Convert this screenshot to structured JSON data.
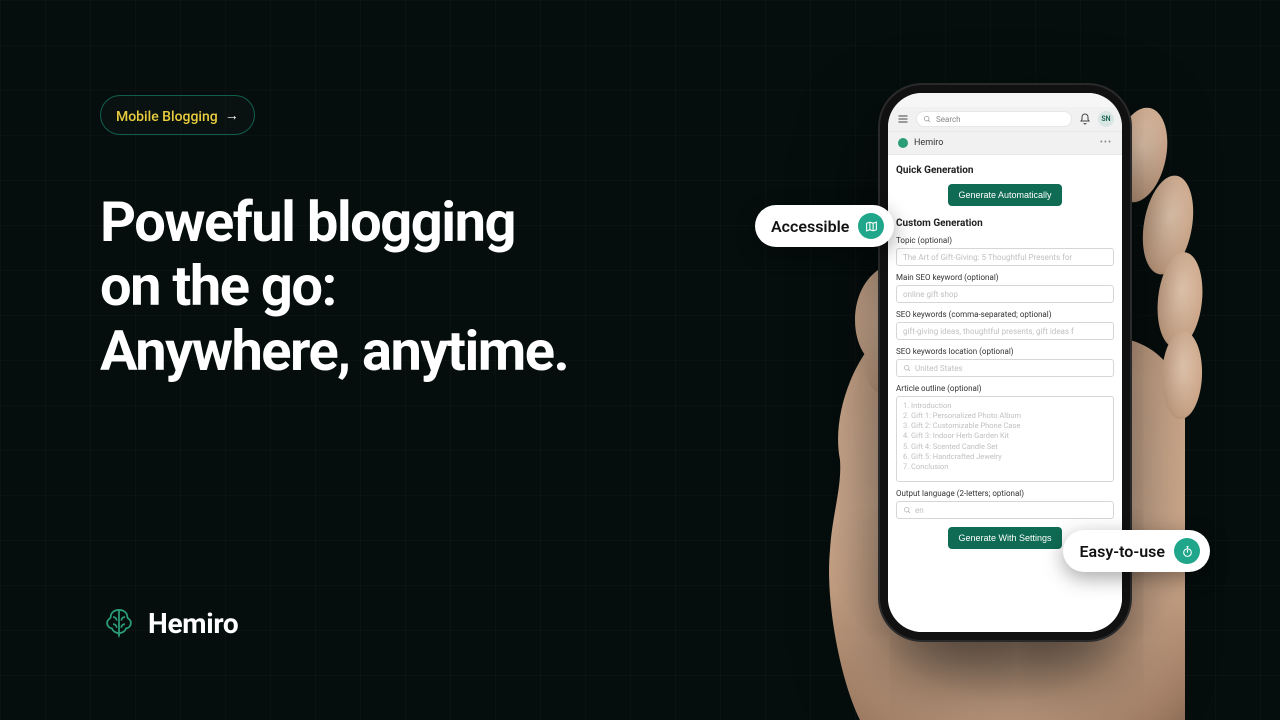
{
  "tag": {
    "label": "Mobile Blogging",
    "arrow": "→"
  },
  "headline": "Poweful blogging\non the go:\nAnywhere, anytime.",
  "brand": {
    "name": "Hemiro"
  },
  "bubble_a": "Accessible",
  "bubble_b": "Easy-to-use",
  "colors": {
    "accent": "#0f6b53",
    "bubble_icon_bg": "#20a68a",
    "tag_text": "#e8cc3e"
  },
  "app": {
    "search_placeholder": "Search",
    "avatar_initials": "SN",
    "app_name": "Hemiro",
    "quick_title": "Quick Generation",
    "quick_button": "Generate Automatically",
    "custom_title": "Custom Generation",
    "topic_label": "Topic (optional)",
    "topic_placeholder": "The Art of Gift-Giving: 5 Thoughtful Presents for",
    "main_kw_label": "Main SEO keyword (optional)",
    "main_kw_placeholder": "online gift shop",
    "kw_label": "SEO keywords (comma-separated; optional)",
    "kw_placeholder": "gift-giving ideas, thoughtful presents, gift ideas f",
    "loc_label": "SEO keywords location (optional)",
    "loc_placeholder": "United States",
    "outline_label": "Article outline (optional)",
    "outline_placeholder": "1. Introduction\n2. Gift 1: Personalized Photo Album\n3. Gift 2: Customizable Phone Case\n4. Gift 3: Indoor Herb Garden Kit\n5. Gift 4: Scented Candle Set\n6. Gift 5: Handcrafted Jewelry\n7. Conclusion",
    "lang_label": "Output language (2-letters; optional)",
    "lang_placeholder": "en",
    "custom_button": "Generate With Settings"
  }
}
